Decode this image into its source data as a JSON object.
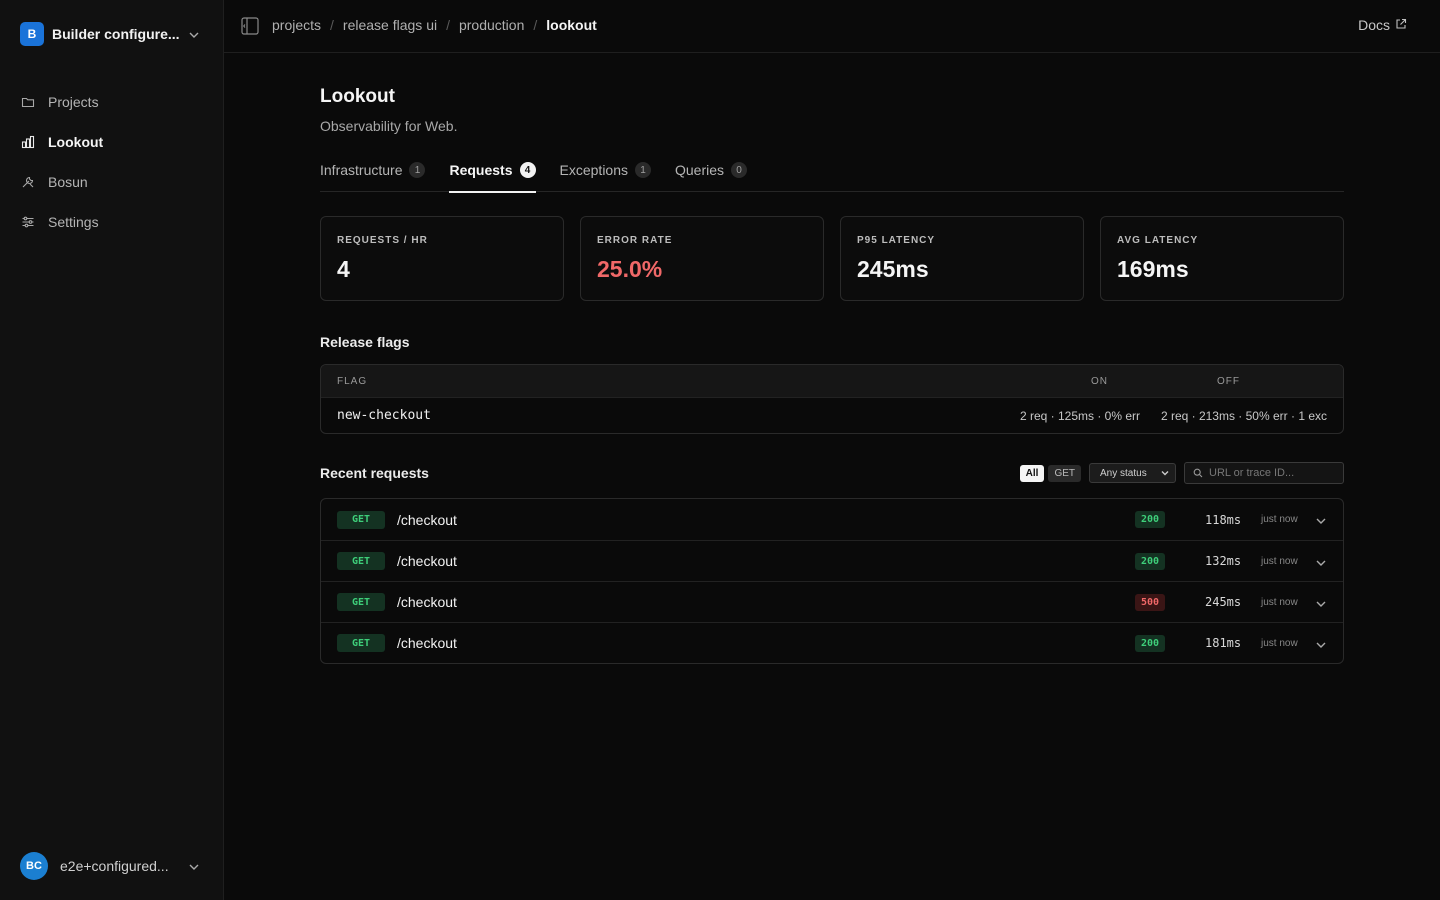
{
  "sidebar": {
    "org_initial": "B",
    "org_name": "Builder configure...",
    "items": [
      {
        "label": "Projects",
        "icon": "folder-icon"
      },
      {
        "label": "Lookout",
        "icon": "bar-chart-icon"
      },
      {
        "label": "Bosun",
        "icon": "tools-icon"
      },
      {
        "label": "Settings",
        "icon": "sliders-icon"
      }
    ],
    "active_item": "Lookout",
    "user_initials": "BC",
    "user_name": "e2e+configured..."
  },
  "breadcrumbs": [
    "projects",
    "release flags ui",
    "production",
    "lookout"
  ],
  "docs_label": "Docs",
  "page": {
    "title": "Lookout",
    "subtitle": "Observability for Web."
  },
  "tabs": [
    {
      "label": "Infrastructure",
      "count": "1"
    },
    {
      "label": "Requests",
      "count": "4"
    },
    {
      "label": "Exceptions",
      "count": "1"
    },
    {
      "label": "Queries",
      "count": "0"
    }
  ],
  "active_tab": "Requests",
  "stats": [
    {
      "label": "REQUESTS / HR",
      "value": "4"
    },
    {
      "label": "ERROR RATE",
      "value": "25.0%"
    },
    {
      "label": "P95 LATENCY",
      "value": "245ms"
    },
    {
      "label": "AVG LATENCY",
      "value": "169ms"
    }
  ],
  "release_flags": {
    "title": "Release flags",
    "columns": [
      "FLAG",
      "ON",
      "OFF"
    ],
    "rows": [
      {
        "flag": "new-checkout",
        "on": "2 req · 125ms · 0% err",
        "off": "2 req · 213ms · 50% err · 1 exc"
      }
    ]
  },
  "recent_requests": {
    "title": "Recent requests",
    "filter_all": "All",
    "filter_get": "GET",
    "status_select": "Any status",
    "search_placeholder": "URL or trace ID...",
    "rows": [
      {
        "method": "GET",
        "path": "/checkout",
        "status": "200",
        "duration": "118ms",
        "when": "just now"
      },
      {
        "method": "GET",
        "path": "/checkout",
        "status": "200",
        "duration": "132ms",
        "when": "just now"
      },
      {
        "method": "GET",
        "path": "/checkout",
        "status": "500",
        "duration": "245ms",
        "when": "just now"
      },
      {
        "method": "GET",
        "path": "/checkout",
        "status": "200",
        "duration": "181ms",
        "when": "just now"
      }
    ]
  },
  "colors": {
    "background": "#0a0a0a",
    "accent": "#1a73d9",
    "success": "#3ecf7a",
    "error": "#f06868"
  }
}
